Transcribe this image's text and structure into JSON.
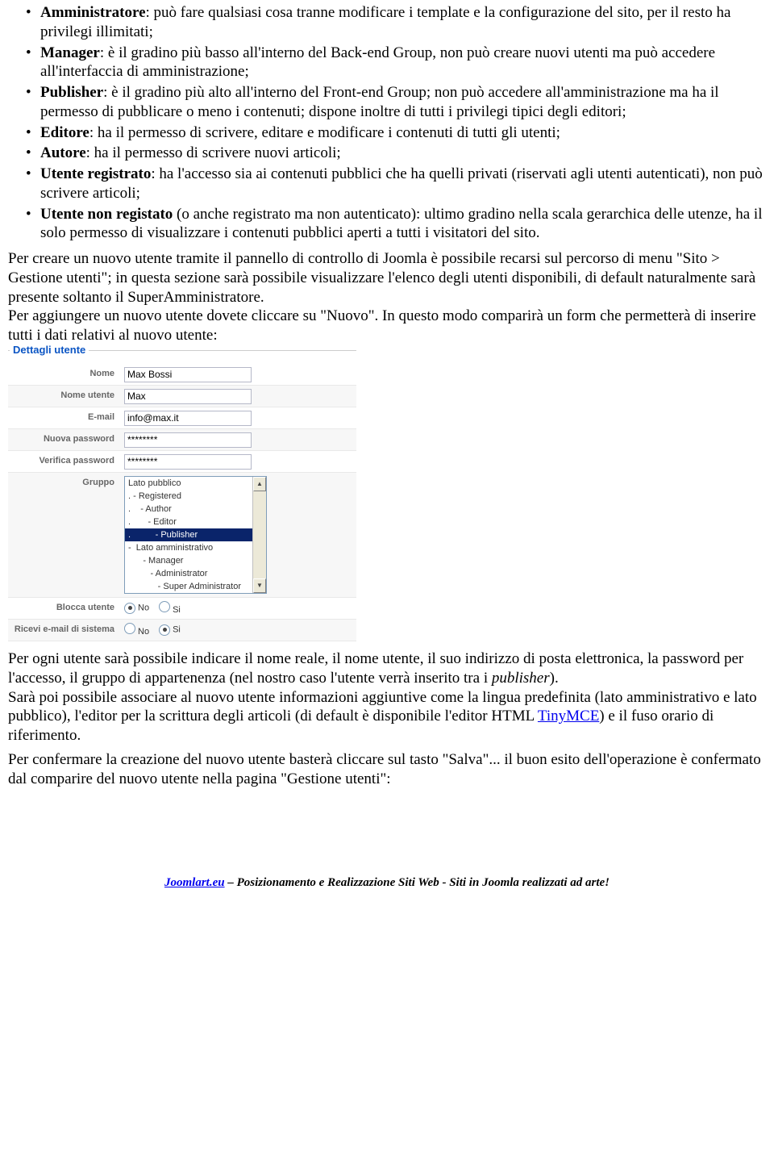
{
  "roles": [
    {
      "name": "Amministratore",
      "text": ": può fare qualsiasi cosa tranne modificare i template e la configurazione del sito, per il resto ha privilegi illimitati;"
    },
    {
      "name": "Manager",
      "text": ": è il gradino più basso all'interno del Back-end Group, non può creare nuovi utenti ma può accedere all'interfaccia di amministrazione;"
    },
    {
      "name": "Publisher",
      "text": ": è il gradino più alto all'interno del Front-end Group; non può accedere all'amministrazione ma ha il permesso di pubblicare o meno i contenuti; dispone inoltre di tutti i privilegi tipici degli editori;"
    },
    {
      "name": "Editore",
      "text": ": ha il permesso di scrivere, editare e modificare i contenuti di tutti gli utenti;"
    },
    {
      "name": "Autore",
      "text": ": ha il permesso di scrivere nuovi articoli;"
    },
    {
      "name": "Utente registrato",
      "text": ": ha l'accesso sia ai contenuti pubblici che ha quelli privati (riservati agli utenti autenticati), non può scrivere articoli;"
    },
    {
      "name": "Utente non registato",
      "text": " (o anche registrato ma non autenticato): ultimo gradino nella scala gerarchica delle utenze, ha il solo permesso di visualizzare i contenuti pubblici aperti a tutti i visitatori del sito."
    }
  ],
  "para1": "Per creare un nuovo utente tramite il pannello di controllo di Joomla è possibile recarsi sul percorso di menu \"Sito > Gestione utenti\"; in questa sezione sarà possibile visualizzare l'elenco degli utenti disponibili, di default naturalmente sarà presente soltanto il SuperAmministratore.",
  "para1b": "Per aggiungere un nuovo utente dovete cliccare su \"Nuovo\". In questo modo comparirà un form che permetterà di inserire tutti i dati relativi al nuovo utente:",
  "form": {
    "legend": "Dettagli utente",
    "labels": {
      "nome": "Nome",
      "nome_utente": "Nome utente",
      "email": "E-mail",
      "nuova_pwd": "Nuova password",
      "verifica_pwd": "Verifica password",
      "gruppo": "Gruppo",
      "blocca": "Blocca utente",
      "ricevi": "Ricevi e-mail di sistema"
    },
    "values": {
      "nome": "Max Bossi",
      "nome_utente": "Max",
      "email": "info@max.it",
      "nuova_pwd": "********",
      "verifica_pwd": "********"
    },
    "group_options": [
      "Lato pubblico",
      ". - Registered",
      ".    - Author",
      ".       - Editor",
      ".          - Publisher",
      "-  Lato amministrativo",
      "      - Manager",
      "         - Administrator",
      "            - Super Administrator"
    ],
    "group_selected_index": 4,
    "radio": {
      "no": "No",
      "si": "Si"
    }
  },
  "para2a": "Per ogni utente sarà possibile indicare il nome reale, il nome utente, il suo indirizzo di posta elettronica, la password per l'accesso, il gruppo di appartenenza (nel nostro caso l'utente verrà inserito tra i ",
  "para2_em": "publisher",
  "para2b": ").",
  "para3a": "Sarà poi possibile associare al nuovo utente informazioni aggiuntive come la lingua predefinita (lato amministrativo e lato pubblico), l'editor per la scrittura degli articoli (di default è disponibile l'editor HTML ",
  "para3_link": "TinyMCE",
  "para3b": ") e il fuso orario di riferimento.",
  "para4": "Per confermare la creazione del nuovo utente basterà cliccare sul tasto \"Salva\"... il buon esito dell'operazione è confermato dal comparire del nuovo utente nella pagina \"Gestione utenti\":",
  "footer": {
    "link": "Joomlart.eu",
    "text": " –  Posizionamento e Realizzazione Siti Web - Siti in Joomla realizzati ad arte!"
  }
}
